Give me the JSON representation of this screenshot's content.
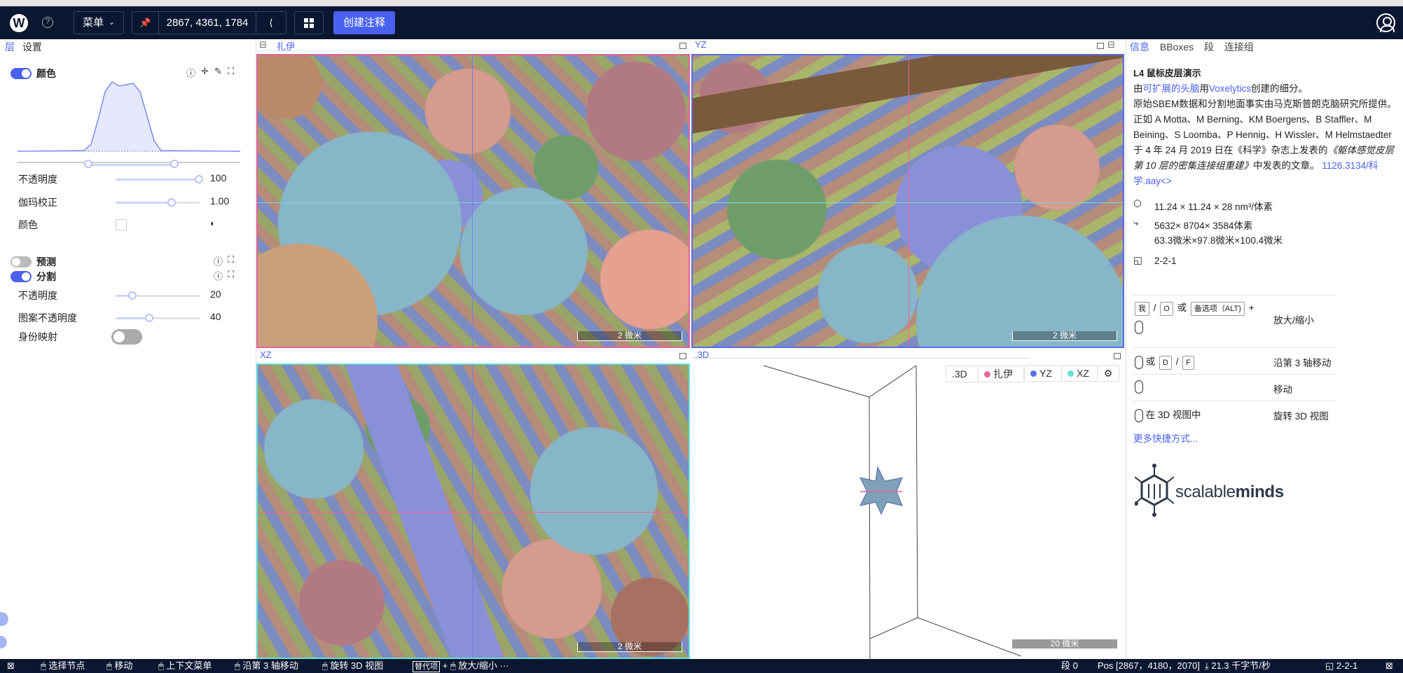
{
  "topbar": {
    "menu_label": "菜单",
    "position": "2867, 4361, 1784",
    "create_annotation": "创建注释"
  },
  "left_panel": {
    "tabs": [
      "层",
      "设置"
    ],
    "color_layer": {
      "name": "颜色",
      "opacity_label": "不透明度",
      "opacity_value": "100",
      "gamma_label": "伽玛校正",
      "gamma_value": "1.00",
      "color_label": "颜色"
    },
    "prediction_layer": {
      "name": "预测"
    },
    "segmentation_layer": {
      "name": "分割",
      "opacity_label": "不透明度",
      "opacity_value": "20",
      "pattern_opacity_label": "图案不透明度",
      "pattern_opacity_value": "40",
      "id_mapping_label": "身份映射"
    }
  },
  "viewports": {
    "xy": {
      "label": "扎伊",
      "scale": "2 微米"
    },
    "yz": {
      "label": "YZ",
      "scale": "2 微米"
    },
    "xz": {
      "label": "XZ",
      "scale": "2 微米"
    },
    "td": {
      "label": ".3D",
      "scale": "20 微米",
      "toolbar": [
        ".3D",
        "扎伊",
        "YZ",
        "XZ"
      ]
    }
  },
  "right_panel": {
    "tabs": [
      "信息",
      "BBoxes",
      "段",
      "连接组"
    ],
    "title": "L4 鼠标皮层演示",
    "desc_prefix": "由",
    "desc_link1": "可扩展的头脑",
    "desc_mid": "用",
    "desc_link2": "Voxelytics",
    "desc_suffix": "创建的细分。",
    "desc_body": "原始SBEM数据和分割地面事实由马克斯普朗克脑研究所提供。正如 A Motta、M Berning、KM Boergens、B Staffler、M Beining、S Loomba、P Hennig、H Wissler、M Helmstaedter 于 4 年 24 月 2019 日在《科学》杂志上发表的",
    "desc_italic": "《躯体感觉皮层第 10 层的密集连接组重建》",
    "desc_end": "中发表的文章。",
    "desc_doi": "1126.3134/科学.aay<>",
    "voxel_size": "11.24 × 11.24 × 28 nm³/体素",
    "extent_vx": "5632× 8704× 3584体素",
    "extent_um": "63.3微米×97.8微米×100.4微米",
    "mag": "2-2-1",
    "shortcuts": [
      {
        "keys": [
          "我",
          "O"
        ],
        "or": "或",
        "alt": "备选项（ALT)",
        "plus": "+",
        "action": "放大/缩小"
      },
      {
        "keys": [
          "D",
          "F"
        ],
        "or": "或",
        "action": "沿第 3 轴移动"
      },
      {
        "action": "移动"
      },
      {
        "prefix": "在 3D 视图中",
        "action": "旋转 3D 视图"
      }
    ],
    "more_shortcuts": "更多快捷方式...",
    "logo_text_a": "scalable",
    "logo_text_b": "minds"
  },
  "statusbar": {
    "items": [
      "选择节点",
      "移动",
      "上下文菜单",
      "沿第 3 轴移动",
      "旋转 3D 视图"
    ],
    "alt_key": "替代项",
    "zoom": "放大/缩小",
    "ellipsis": "···",
    "segment": "段 0",
    "pos": "Pos [2867，4180，2070]",
    "speed": "21.3 千字节/秒",
    "mag": "2-2-1"
  },
  "colors": {
    "accent": "#4a61f0",
    "topbar_bg": "#0b1630",
    "xy_border": "#e8649a",
    "yz_border": "#5a6cf0",
    "xz_border": "#66e0d8"
  }
}
